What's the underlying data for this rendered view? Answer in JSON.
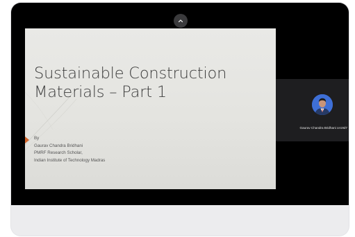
{
  "meeting": {
    "collapse_icon": "chevron-up-icon",
    "slide": {
      "title_line1": "Sustainable Construction",
      "title_line2": "Materials – Part 1",
      "by_label": "By",
      "presenter_name": "Gaurav Chandra Bridhani",
      "presenter_role": "PMRF Research Scholar,",
      "presenter_institution": "Indian Institute of Technology Madras",
      "accent_color": "#d3652a"
    },
    "participant": {
      "name": "Gaurav Chandra Bridhani ce19d7",
      "avatar_icon": "user-avatar-photo"
    }
  },
  "colors": {
    "background": "#000000",
    "tile": "#1e1e20",
    "footer": "#ececee"
  }
}
